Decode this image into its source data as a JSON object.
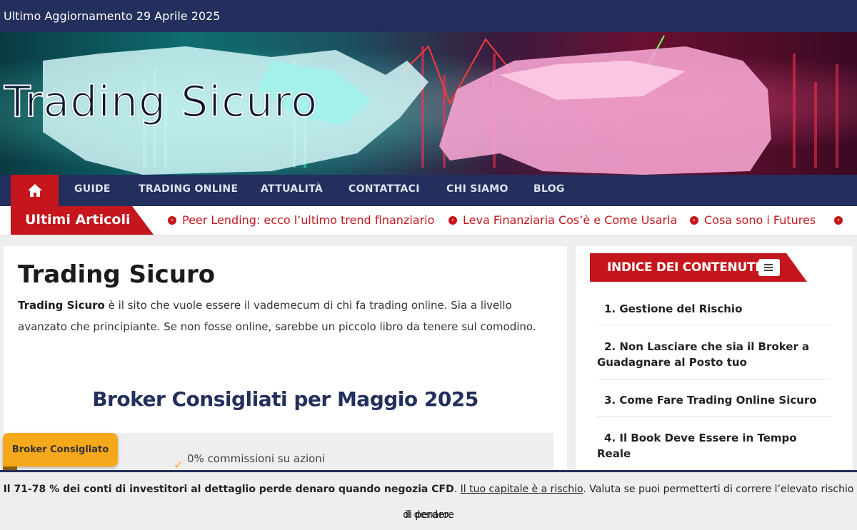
{
  "topbar": {
    "date_text": "Ultimo Aggiornamento 29 Aprile 2025"
  },
  "header": {
    "site_title": "Trading Sicuro"
  },
  "nav": {
    "home_icon": "home-icon",
    "items": [
      "GUIDE",
      "TRADING ONLINE",
      "ATTUALITÀ",
      "CONTATTACI",
      "CHI SIAMO",
      "BLOG"
    ]
  },
  "ticker": {
    "label": "Ultimi Articoli",
    "items": [
      "Peer Lending: ecco l’ultimo trend finanziario",
      "Leva Finanziaria Cos’è e Come Usarla",
      "Cosa sono i Futures"
    ]
  },
  "main": {
    "title": "Trading Sicuro",
    "intro_bold": "Trading Sicuro",
    "intro_rest": " è il sito che vuole essere il vademecum di chi fa trading online. Sia a livello avanzato che principiante. Se non fosse online, sarebbe un piccolo libro da tenere sul comodino.",
    "broker_heading": "Broker Consigliati per Maggio 2025",
    "badge": "Broker Consigliato",
    "feature_text": "0% commissioni su azioni"
  },
  "sidebar": {
    "toc_title": "INDICE DEI CONTENUTI",
    "toc_items": [
      "1. Gestione del Rischio",
      "2. Non Lasciare che sia il Broker a Guadagnare al Posto tuo",
      "3. Come Fare Trading Online Sicuro",
      "4. Il Book Deve Essere in Tempo Reale"
    ]
  },
  "disclaimer": {
    "bold": "Il 71-78 % dei conti di investitori al dettaglio perde denaro quando negozia CFD",
    "link": "Il tuo capitale è a rischio",
    "rest": ". Valuta se puoi permetterti di correre l’elevato rischio di perdere",
    "line2": "il denaro."
  },
  "colors": {
    "navy": "#232f5c",
    "red": "#c4161c",
    "orange": "#f6a81b"
  }
}
